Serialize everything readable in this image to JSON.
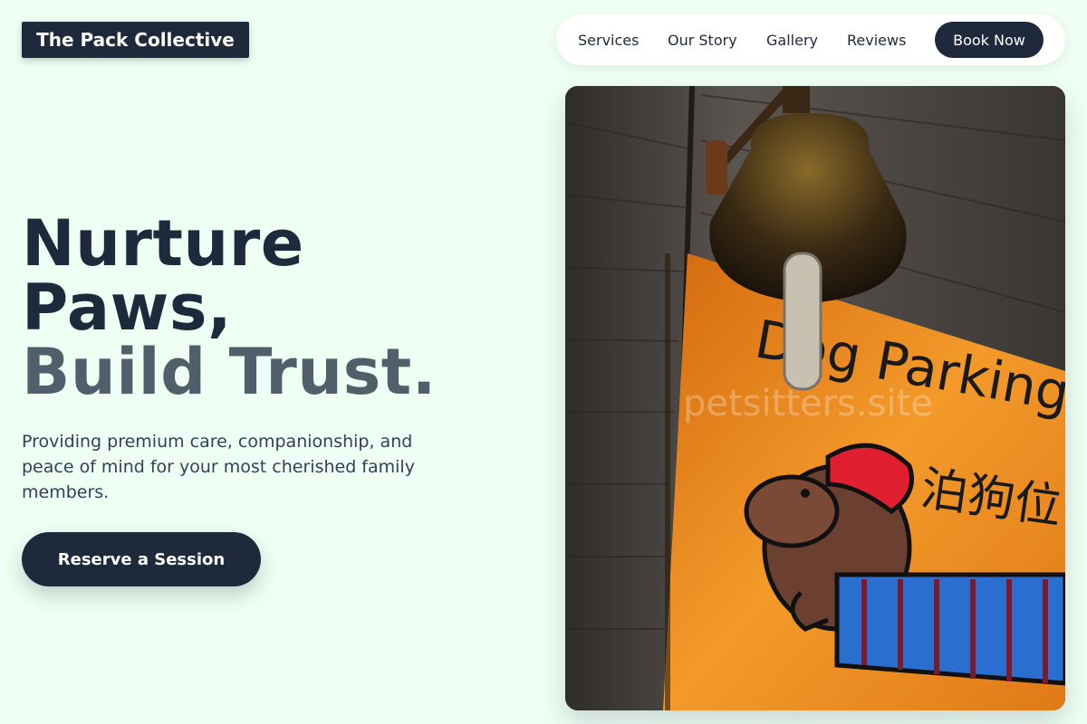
{
  "brand": {
    "name": "The Pack Collective"
  },
  "nav": {
    "items": [
      "Services",
      "Our Story",
      "Gallery",
      "Reviews"
    ],
    "cta_label": "Book Now"
  },
  "hero": {
    "headline_line1": "Nurture",
    "headline_line2": "Paws,",
    "headline_line3": "Build Trust.",
    "lead": "Providing premium care, companionship, and peace of mind for your most cherished family members.",
    "cta_label": "Reserve a Session",
    "image": {
      "watermark": "petsitters.site",
      "sign_text": "Dog Parking",
      "sign_text_cjk": "泊狗位"
    }
  },
  "colors": {
    "page_bg": "#effff3",
    "primary": "#1e293b",
    "muted_heading": "#525f6b",
    "sign_orange": "#f08a1c"
  }
}
